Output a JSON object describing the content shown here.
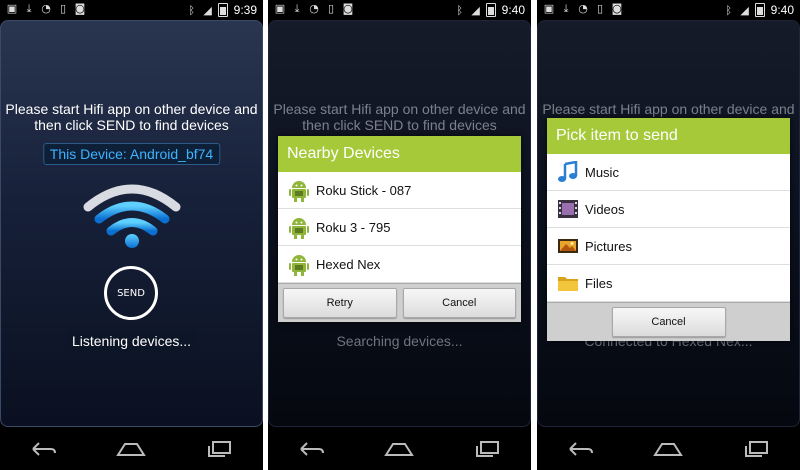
{
  "accent_color": "#a6c93a",
  "link_color": "#3fb3ff",
  "screens": [
    {
      "status": {
        "time": "9:39"
      },
      "prompt_line1": "Please start Hifi app on other device and",
      "prompt_line2": "then click SEND to find devices",
      "device_label": "This Device: Android_bf74",
      "send_label": "SEND",
      "status_message": "Listening devices..."
    },
    {
      "status": {
        "time": "9:40"
      },
      "prompt_line1": "Please start Hifi app on other device and",
      "prompt_line2": "then click SEND to find devices",
      "status_message": "Searching devices...",
      "dialog": {
        "title": "Nearby Devices",
        "items": [
          {
            "label": "Roku Stick - 087",
            "icon": "android-icon"
          },
          {
            "label": "Roku 3 - 795",
            "icon": "android-icon"
          },
          {
            "label": "Hexed Nex",
            "icon": "android-icon"
          }
        ],
        "retry_label": "Retry",
        "cancel_label": "Cancel"
      }
    },
    {
      "status": {
        "time": "9:40"
      },
      "prompt_line1": "Please start Hifi app on other device and",
      "status_message": "Connected to Hexed Nex...",
      "dialog": {
        "title": "Pick item to send",
        "items": [
          {
            "label": "Music",
            "icon": "music-icon"
          },
          {
            "label": "Videos",
            "icon": "video-icon"
          },
          {
            "label": "Pictures",
            "icon": "pictures-icon"
          },
          {
            "label": "Files",
            "icon": "folder-icon"
          }
        ],
        "cancel_label": "Cancel"
      }
    }
  ]
}
